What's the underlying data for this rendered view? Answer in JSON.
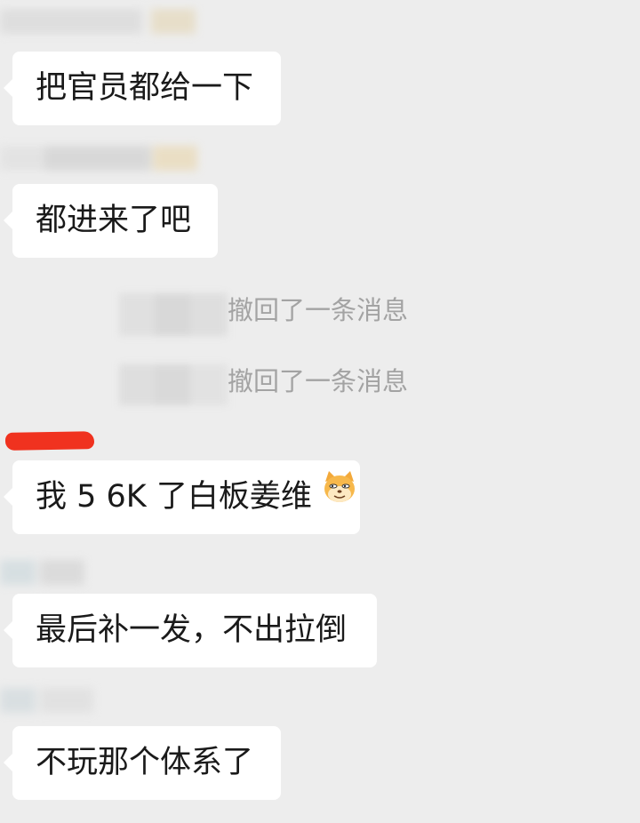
{
  "colors": {
    "background": "#ededed",
    "bubble": "#ffffff",
    "text": "#1a1a1a",
    "system_text": "#a3a3a3",
    "highlight_mark": "#f0321f"
  },
  "messages": [
    {
      "text": "把官员都给一下"
    },
    {
      "text": "都进来了吧"
    },
    {
      "text": "我 5 6K 了白板姜维",
      "emoji": "doge-cat-emoji"
    },
    {
      "text": "最后补一发，不出拉倒"
    },
    {
      "text": "不玩那个体系了"
    }
  ],
  "system_notices": [
    {
      "text": "撤回了一条消息"
    },
    {
      "text": "撤回了一条消息"
    }
  ]
}
